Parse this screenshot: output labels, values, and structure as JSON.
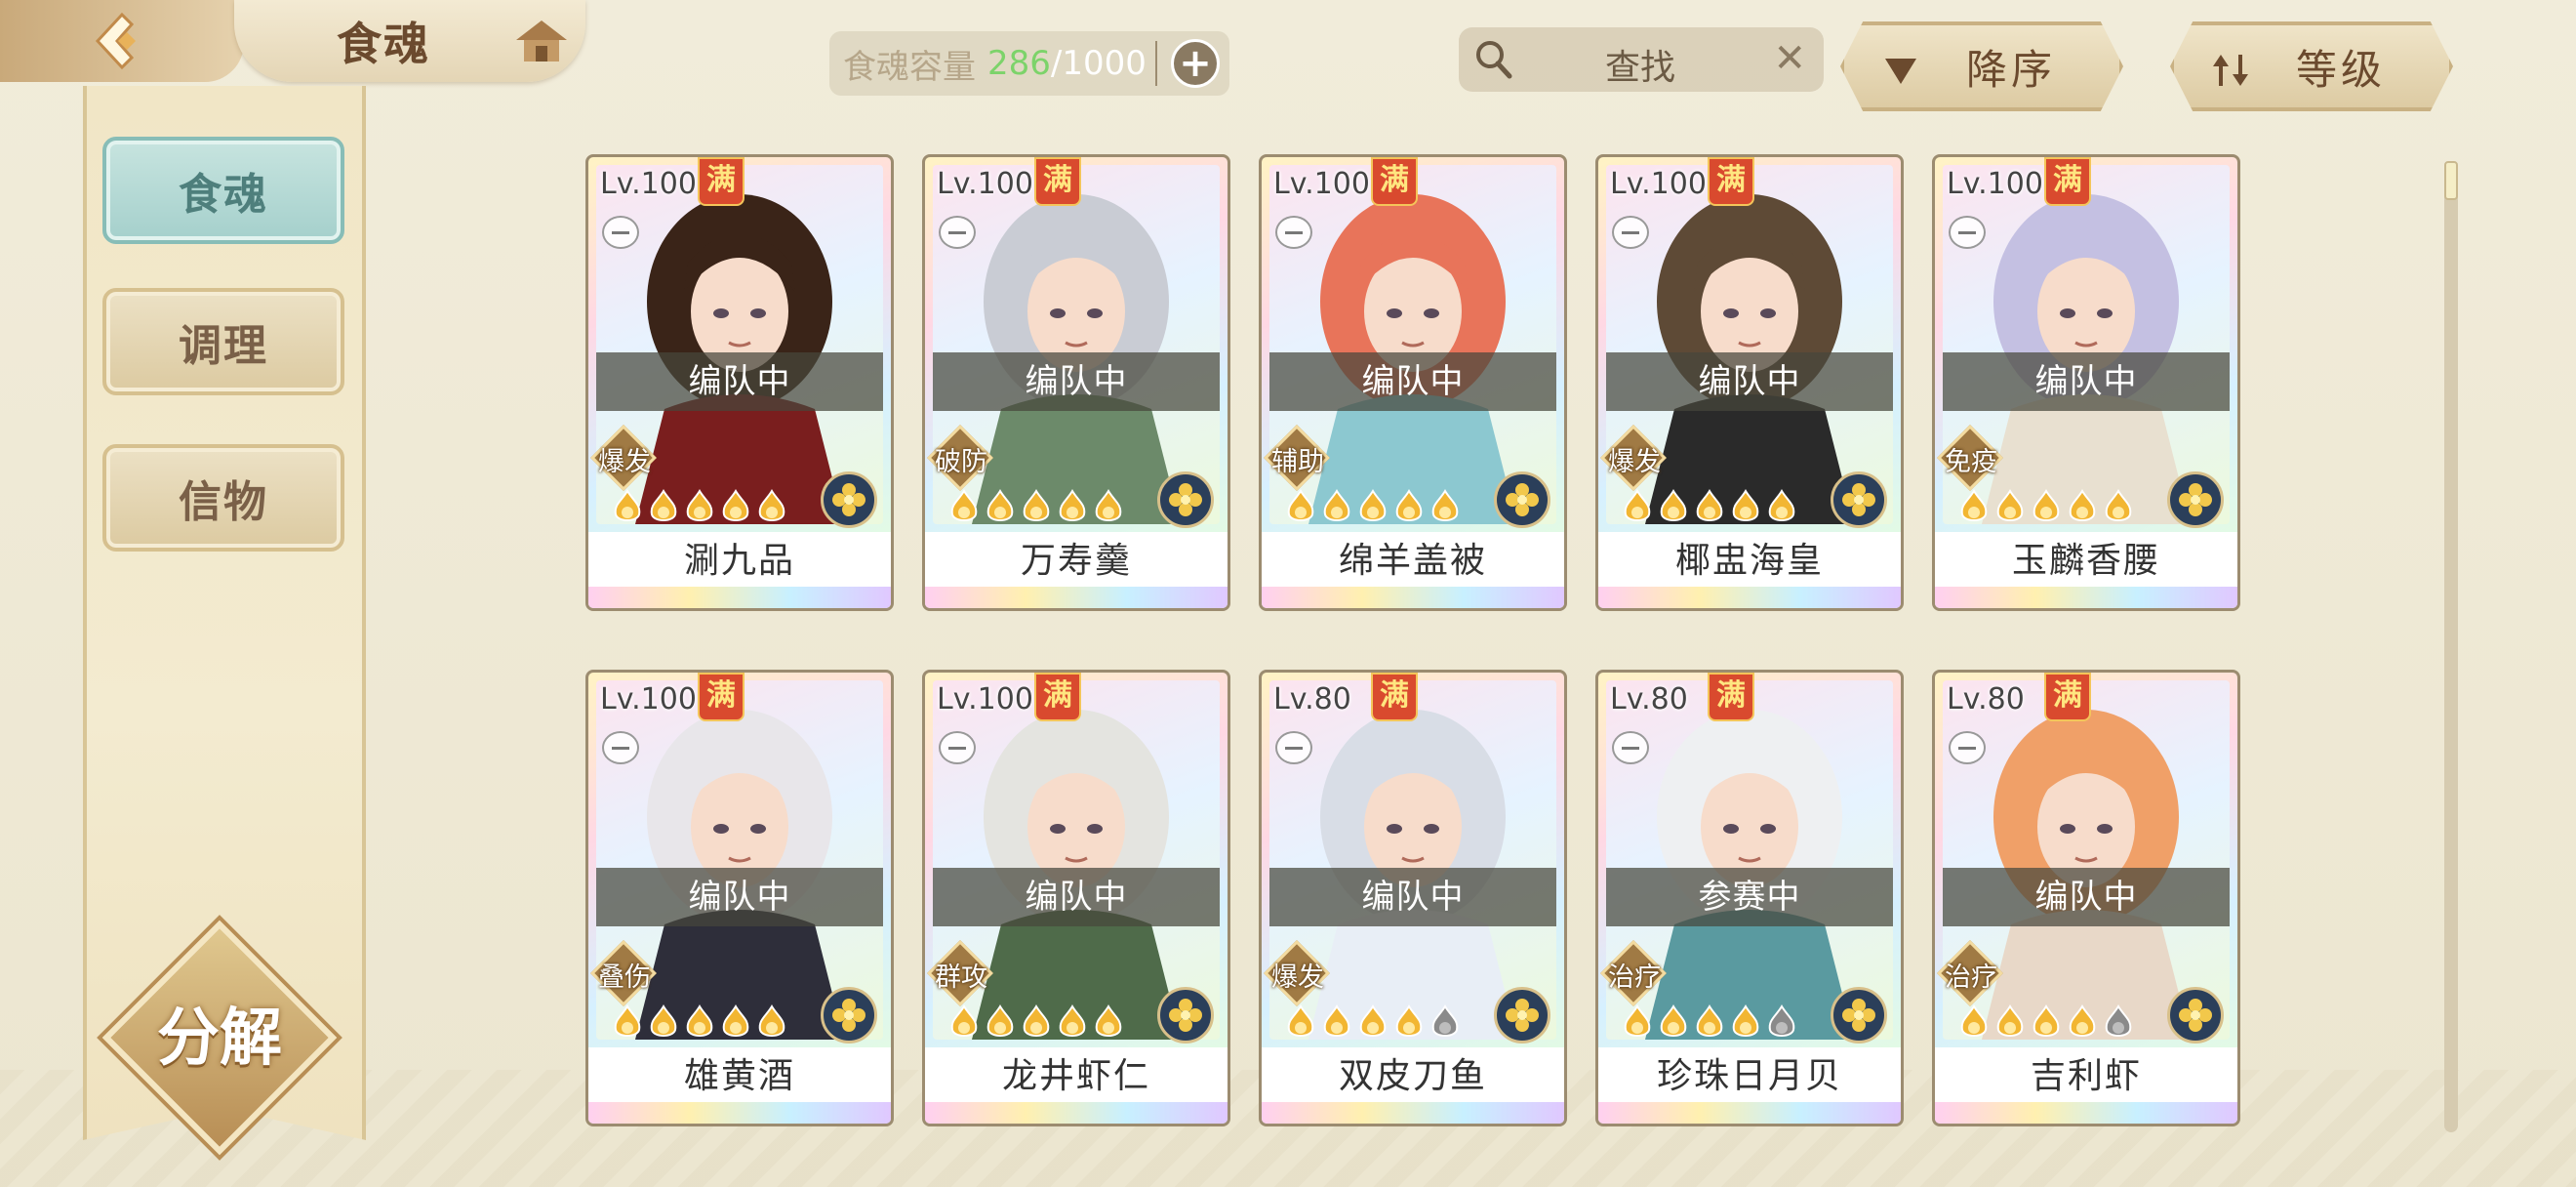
{
  "header": {
    "title": "食魂",
    "capacity_label": "食魂容量",
    "capacity_current": "286",
    "capacity_sep": "/",
    "capacity_max": "1000",
    "search_label": "查找",
    "search_clear": "✕",
    "sort_order_label": "降序",
    "sort_by_label": "等级"
  },
  "sidebar": {
    "tabs": [
      {
        "label": "食魂",
        "active": true
      },
      {
        "label": "调理",
        "active": false
      },
      {
        "label": "信物",
        "active": false
      }
    ],
    "decompose_label": "分解"
  },
  "cards": [
    {
      "level": "Lv.100",
      "full": "满",
      "status": "编队中",
      "role": "爆发",
      "stars": 5,
      "name": "涮九品"
    },
    {
      "level": "Lv.100",
      "full": "满",
      "status": "编队中",
      "role": "破防",
      "stars": 5,
      "name": "万寿羹"
    },
    {
      "level": "Lv.100",
      "full": "满",
      "status": "编队中",
      "role": "辅助",
      "stars": 5,
      "name": "绵羊盖被"
    },
    {
      "level": "Lv.100",
      "full": "满",
      "status": "编队中",
      "role": "爆发",
      "stars": 5,
      "name": "椰盅海皇"
    },
    {
      "level": "Lv.100",
      "full": "满",
      "status": "编队中",
      "role": "免疫",
      "stars": 5,
      "name": "玉麟香腰"
    },
    {
      "level": "Lv.100",
      "full": "满",
      "status": "编队中",
      "role": "叠伤",
      "stars": 5,
      "name": "雄黄酒"
    },
    {
      "level": "Lv.100",
      "full": "满",
      "status": "编队中",
      "role": "群攻",
      "stars": 5,
      "name": "龙井虾仁"
    },
    {
      "level": "Lv.80",
      "full": "满",
      "status": "编队中",
      "role": "爆发",
      "stars": 4,
      "name": "双皮刀鱼"
    },
    {
      "level": "Lv.80",
      "full": "满",
      "status": "参赛中",
      "role": "治疗",
      "stars": 4,
      "name": "珍珠日月贝"
    },
    {
      "level": "Lv.80",
      "full": "满",
      "status": "编队中",
      "role": "治疗",
      "stars": 4,
      "name": "吉利虾"
    }
  ],
  "colors": {
    "accent_green": "#7cd36a",
    "active_tab": "#a5d0cc",
    "full_badge": "#d94a2e",
    "star_gold": "#f2b632"
  },
  "scroll_position": 0
}
